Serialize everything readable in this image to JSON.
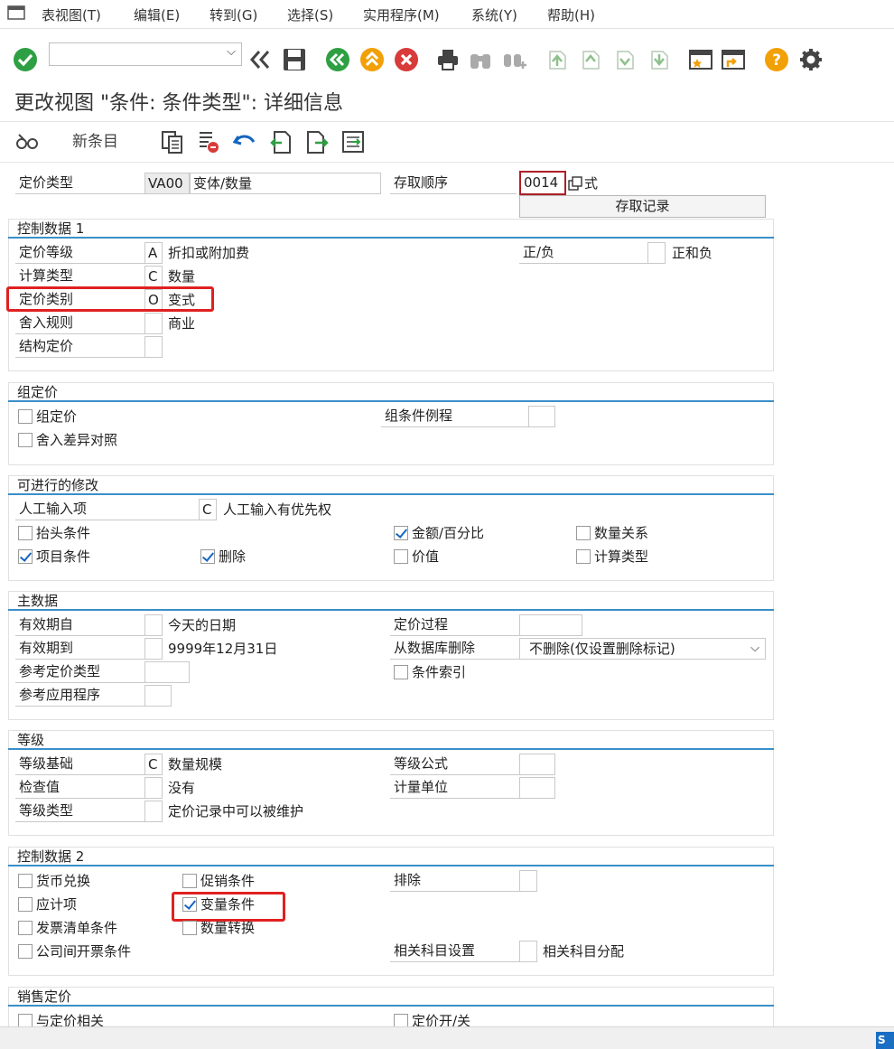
{
  "menu": [
    "表视图(T)",
    "编辑(E)",
    "转到(G)",
    "选择(S)",
    "实用程序(M)",
    "系统(Y)",
    "帮助(H)"
  ],
  "page_title": "更改视图 \"条件: 条件类型\": 详细信息",
  "app_toolbar": {
    "new_entries": "新条目"
  },
  "header": {
    "pricing_type_label": "定价类型",
    "pricing_type_value": "VA00",
    "pricing_type_desc": "变体/数量",
    "access_seq_label": "存取顺序",
    "access_seq_value": "0014",
    "access_seq_suffix": "式",
    "access_records_button": "存取记录"
  },
  "control1": {
    "title": "控制数据 1",
    "level_label": "定价等级",
    "level_value": "A",
    "level_desc": "折扣或附加费",
    "sign_label": "正/负",
    "sign_desc": "正和负",
    "calc_label": "计算类型",
    "calc_value": "C",
    "calc_desc": "数量",
    "cat_label": "定价类别",
    "cat_value": "O",
    "cat_desc": "变式",
    "round_label": "舍入规则",
    "round_desc": "商业",
    "struct_label": "结构定价"
  },
  "group": {
    "title": "组定价",
    "group_cb": "组定价",
    "rounding_cb": "舍入差异对照",
    "routine_label": "组条件例程"
  },
  "changes": {
    "title": "可进行的修改",
    "manual_label": "人工输入项",
    "manual_value": "C",
    "manual_desc": "人工输入有优先权",
    "header_cb": "抬头条件",
    "amount_cb": "金额/百分比",
    "qty_rel_cb": "数量关系",
    "item_cb": "项目条件",
    "delete_cb": "删除",
    "value_cb": "价值",
    "calc_type_cb": "计算类型"
  },
  "master": {
    "title": "主数据",
    "valid_from_label": "有效期自",
    "valid_from_desc": "今天的日期",
    "procedure_label": "定价过程",
    "valid_to_label": "有效期到",
    "valid_to_desc": "9999年12月31日",
    "delete_db_label": "从数据库删除",
    "delete_db_value": "不删除(仅设置删除标记)",
    "ref_type_label": "参考定价类型",
    "cond_index_cb": "条件索引",
    "ref_app_label": "参考应用程序"
  },
  "scale": {
    "title": "等级",
    "basis_label": "等级基础",
    "basis_value": "C",
    "basis_desc": "数量规模",
    "formula_label": "等级公式",
    "check_label": "检查值",
    "check_desc": "没有",
    "unit_label": "计量单位",
    "type_label": "等级类型",
    "type_desc": "定价记录中可以被维护"
  },
  "control2": {
    "title": "控制数据 2",
    "currency_cb": "货币兑换",
    "promo_cb": "促销条件",
    "exclusion_label": "排除",
    "accrual_cb": "应计项",
    "variant_cb": "变量条件",
    "invoice_cb": "发票清单条件",
    "qty_conv_cb": "数量转换",
    "intercompany_cb": "公司间开票条件",
    "acct_setting_label": "相关科目设置",
    "acct_assign_desc": "相关科目分配"
  },
  "sales": {
    "title": "销售定价",
    "relevant_cb": "与定价相关",
    "switch_cb": "定价开/关"
  },
  "colors": {
    "accent": "#3a8fc8",
    "highlight": "#e02020",
    "ok_green": "#2ea043",
    "cancel_red": "#d93a3a",
    "nav_yellow": "#f2a007"
  }
}
